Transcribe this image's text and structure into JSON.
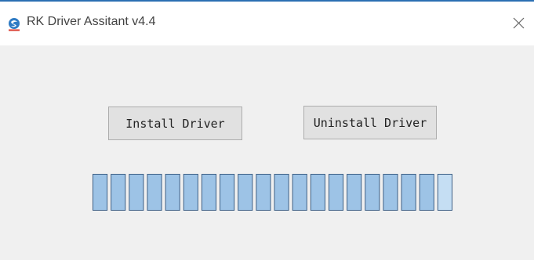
{
  "window": {
    "title": "RK Driver Assitant v4.4",
    "icon": "rk-logo-icon",
    "close_icon": "close-icon"
  },
  "buttons": {
    "install_label": "Install Driver",
    "uninstall_label": "Uninstall Driver"
  },
  "progress": {
    "segments_total": 20,
    "segments_filled": 20,
    "fill_color": "#9dc3e6",
    "last_segment_color": "#c5def3",
    "border_color": "#3d5f85"
  }
}
